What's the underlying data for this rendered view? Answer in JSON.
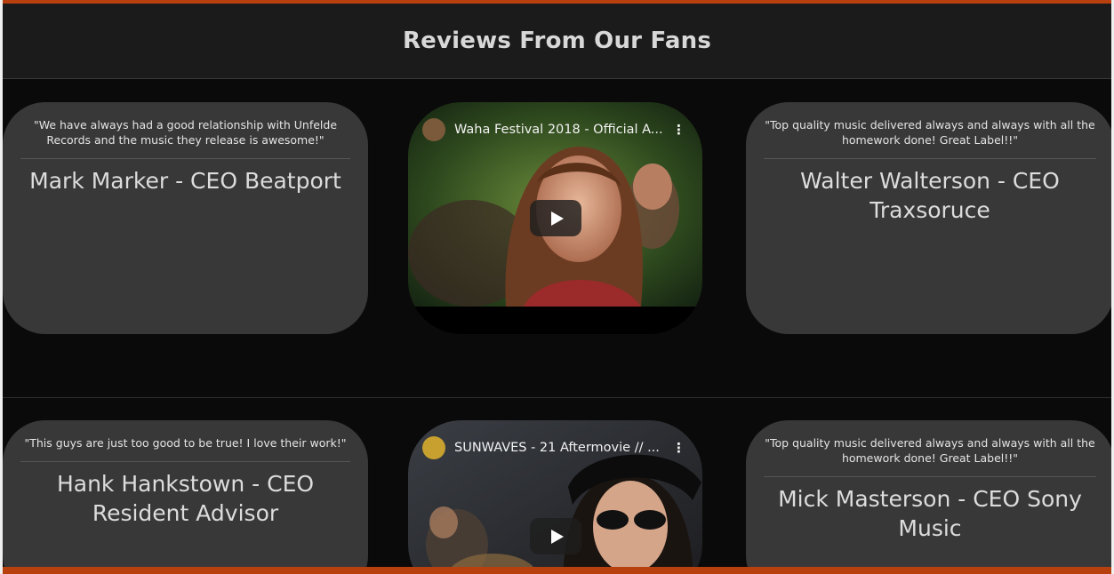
{
  "section": {
    "title": "Reviews From Our Fans"
  },
  "rows": [
    {
      "left": {
        "quote": "\"We have always had a good relationship with Unfelde Records and the music they release is awesome!\"",
        "author": "Mark Marker - CEO Beatport"
      },
      "video": {
        "title": "Waha Festival 2018 - Official A...",
        "menu_icon": "more-vert-icon",
        "play_icon": "play-icon"
      },
      "right": {
        "quote": "\"Top quality music delivered always and always with all the homework done! Great Label!!\"",
        "author": "Walter Walterson - CEO Traxsoruce"
      }
    },
    {
      "left": {
        "quote": "\"This guys are just too good to be true! I love their work!\"",
        "author": "Hank Hankstown - CEO Resident Advisor"
      },
      "video": {
        "title": "SUNWAVES - 21 Aftermovie // ...",
        "menu_icon": "more-vert-icon",
        "play_icon": "play-icon"
      },
      "right": {
        "quote": "\"Top quality music delivered always and always with all the homework done! Great Label!!\"",
        "author": "Mick Masterson - CEO Sony Music"
      }
    }
  ],
  "colors": {
    "accent": "#b8400f",
    "card": "#383838",
    "header_bg": "#1b1b1b",
    "page_bg": "#0a0a0a"
  }
}
